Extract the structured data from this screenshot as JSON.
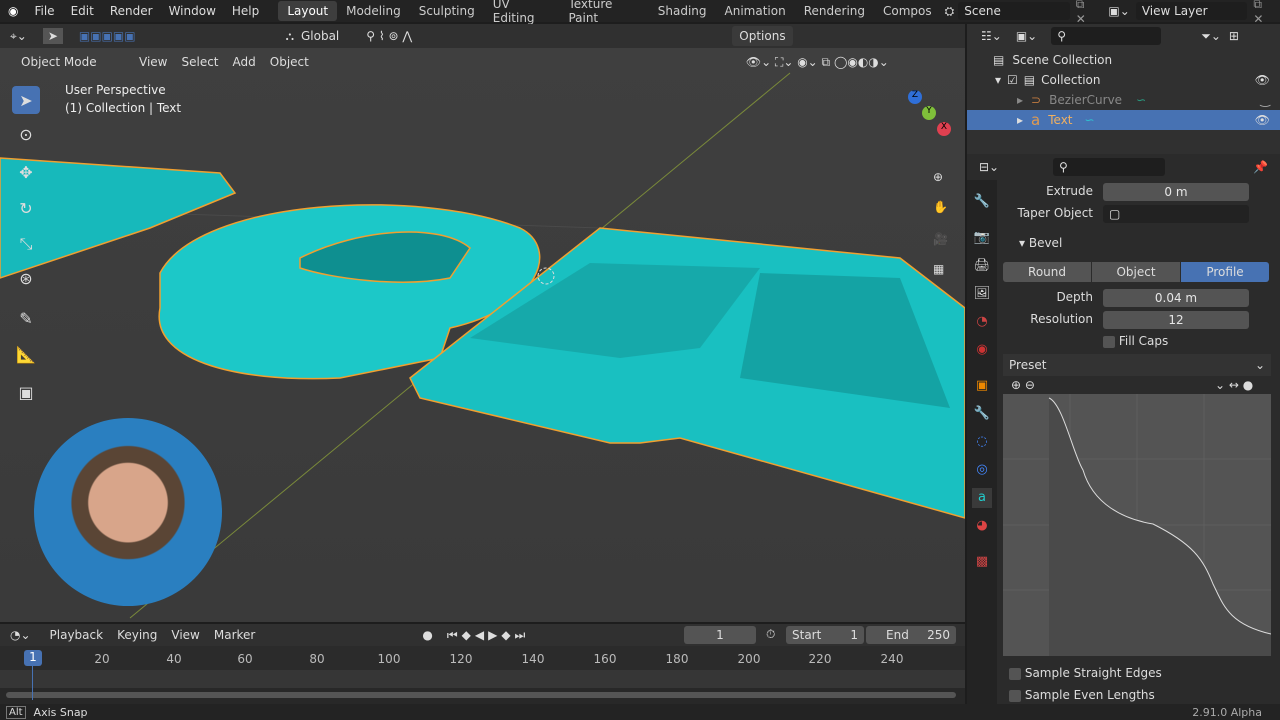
{
  "menu": [
    "File",
    "Edit",
    "Render",
    "Window",
    "Help"
  ],
  "workspaces": [
    "Layout",
    "Modeling",
    "Sculpting",
    "UV Editing",
    "Texture Paint",
    "Shading",
    "Animation",
    "Rendering",
    "Compos"
  ],
  "scene": "Scene",
  "view_layer": "View Layer",
  "toolbar": {
    "orientation": "Global",
    "options": "Options"
  },
  "header": {
    "mode": "Object Mode",
    "view": "View",
    "select": "Select",
    "add": "Add",
    "object": "Object"
  },
  "viewport": {
    "perspective": "User Perspective",
    "context": "(1) Collection | Text",
    "gizmo_axes": [
      "X",
      "Y",
      "Z"
    ]
  },
  "outliner": {
    "root": "Scene Collection",
    "items": [
      {
        "name": "Collection",
        "visible": true
      },
      {
        "name": "BezierCurve",
        "visible": false
      },
      {
        "name": "Text",
        "visible": true,
        "selected": true
      }
    ]
  },
  "properties": {
    "extrude_label": "Extrude",
    "extrude": "0 m",
    "taper_label": "Taper Object",
    "bevel_label": "Bevel",
    "bevel_modes": [
      "Round",
      "Object",
      "Profile"
    ],
    "bevel_active": "Profile",
    "depth_label": "Depth",
    "depth": "0.04 m",
    "resolution_label": "Resolution",
    "resolution": "12",
    "fill_caps": "Fill Caps",
    "preset": "Preset",
    "sample_straight": "Sample Straight Edges",
    "sample_even": "Sample Even Lengths"
  },
  "timeline": {
    "playback": "Playback",
    "keying": "Keying",
    "view": "View",
    "marker": "Marker",
    "current_frame": "1",
    "start_label": "Start",
    "start": "1",
    "end_label": "End",
    "end": "250",
    "ticks": [
      "20",
      "40",
      "60",
      "80",
      "100",
      "120",
      "140",
      "160",
      "180",
      "200",
      "220",
      "240"
    ],
    "playhead": "1"
  },
  "status": {
    "key": "Alt",
    "hint": "Axis Snap",
    "version": "2.91.0 Alpha"
  },
  "colors": {
    "accent": "#4772b3",
    "object": "#1fd8d8",
    "outline": "#f0a030"
  }
}
